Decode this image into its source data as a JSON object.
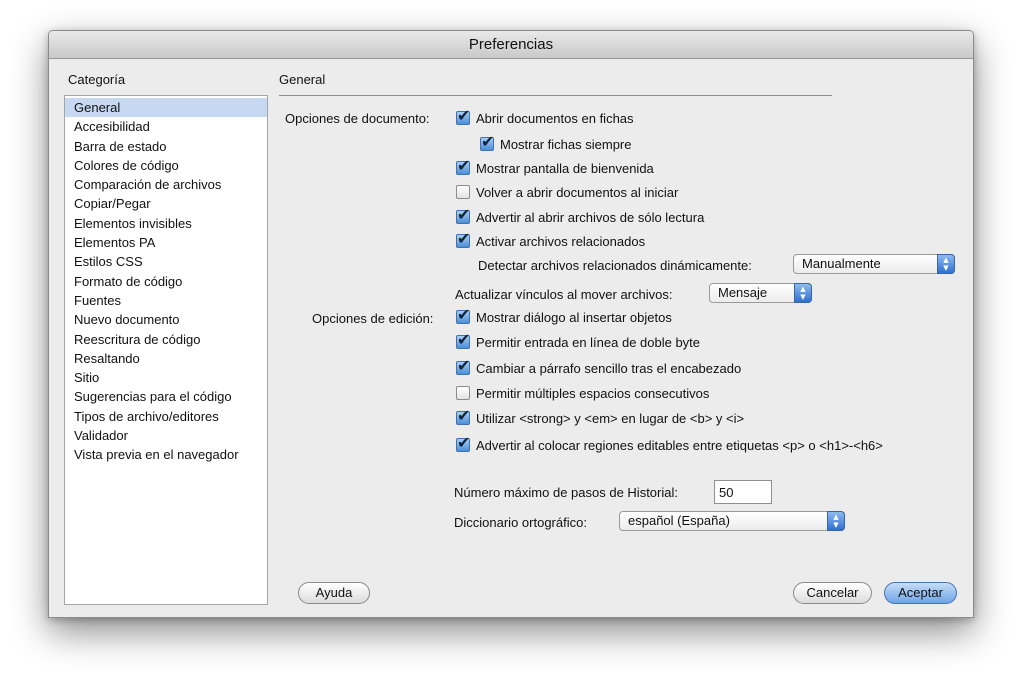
{
  "window": {
    "title": "Preferencias"
  },
  "sidebar": {
    "heading": "Categoría",
    "items": [
      {
        "label": "General",
        "selected": true
      },
      {
        "label": "Accesibilidad"
      },
      {
        "label": "Barra de estado"
      },
      {
        "label": "Colores de código"
      },
      {
        "label": "Comparación de archivos"
      },
      {
        "label": "Copiar/Pegar"
      },
      {
        "label": "Elementos invisibles"
      },
      {
        "label": "Elementos PA"
      },
      {
        "label": "Estilos CSS"
      },
      {
        "label": "Formato de código"
      },
      {
        "label": "Fuentes"
      },
      {
        "label": "Nuevo documento"
      },
      {
        "label": "Reescritura de código"
      },
      {
        "label": "Resaltando"
      },
      {
        "label": "Sitio"
      },
      {
        "label": "Sugerencias para el código"
      },
      {
        "label": "Tipos de archivo/editores"
      },
      {
        "label": "Validador"
      },
      {
        "label": "Vista previa en el navegador"
      }
    ]
  },
  "panel": {
    "title": "General",
    "document_options": {
      "label": "Opciones de documento:",
      "open_in_tabs": {
        "label": "Abrir documentos en fichas",
        "checked": true
      },
      "always_show_tabs": {
        "label": "Mostrar fichas siempre",
        "checked": true
      },
      "show_welcome": {
        "label": "Mostrar pantalla de bienvenida",
        "checked": true
      },
      "reopen_docs": {
        "label": "Volver a abrir documentos al iniciar",
        "checked": false
      },
      "warn_readonly": {
        "label": "Advertir al abrir archivos de sólo lectura",
        "checked": true
      },
      "related_files": {
        "label": "Activar archivos relacionados",
        "checked": true
      },
      "detect_related": {
        "label": "Detectar archivos relacionados dinámicamente:",
        "value": "Manualmente"
      },
      "update_links": {
        "label": "Actualizar vínculos al mover archivos:",
        "value": "Mensaje"
      }
    },
    "editing_options": {
      "label": "Opciones de edición:",
      "show_dialog": {
        "label": "Mostrar diálogo al insertar objetos",
        "checked": true
      },
      "double_byte": {
        "label": "Permitir entrada en línea de doble byte",
        "checked": true
      },
      "paragraph_after_heading": {
        "label": "Cambiar a párrafo sencillo tras el encabezado",
        "checked": true
      },
      "multiple_spaces": {
        "label": "Permitir múltiples espacios consecutivos",
        "checked": false
      },
      "strong_em": {
        "label": "Utilizar <strong> y <em> en lugar de <b> y <i>",
        "checked": true
      },
      "warn_editable": {
        "label": "Advertir al colocar regiones editables entre etiquetas <p> o <h1>-<h6>",
        "checked": true
      }
    },
    "history_steps": {
      "label": "Número máximo de pasos de Historial:",
      "value": "50"
    },
    "spelling": {
      "label": "Diccionario ortográfico:",
      "value": "español (España)"
    }
  },
  "buttons": {
    "help": "Ayuda",
    "cancel": "Cancelar",
    "ok": "Aceptar"
  }
}
